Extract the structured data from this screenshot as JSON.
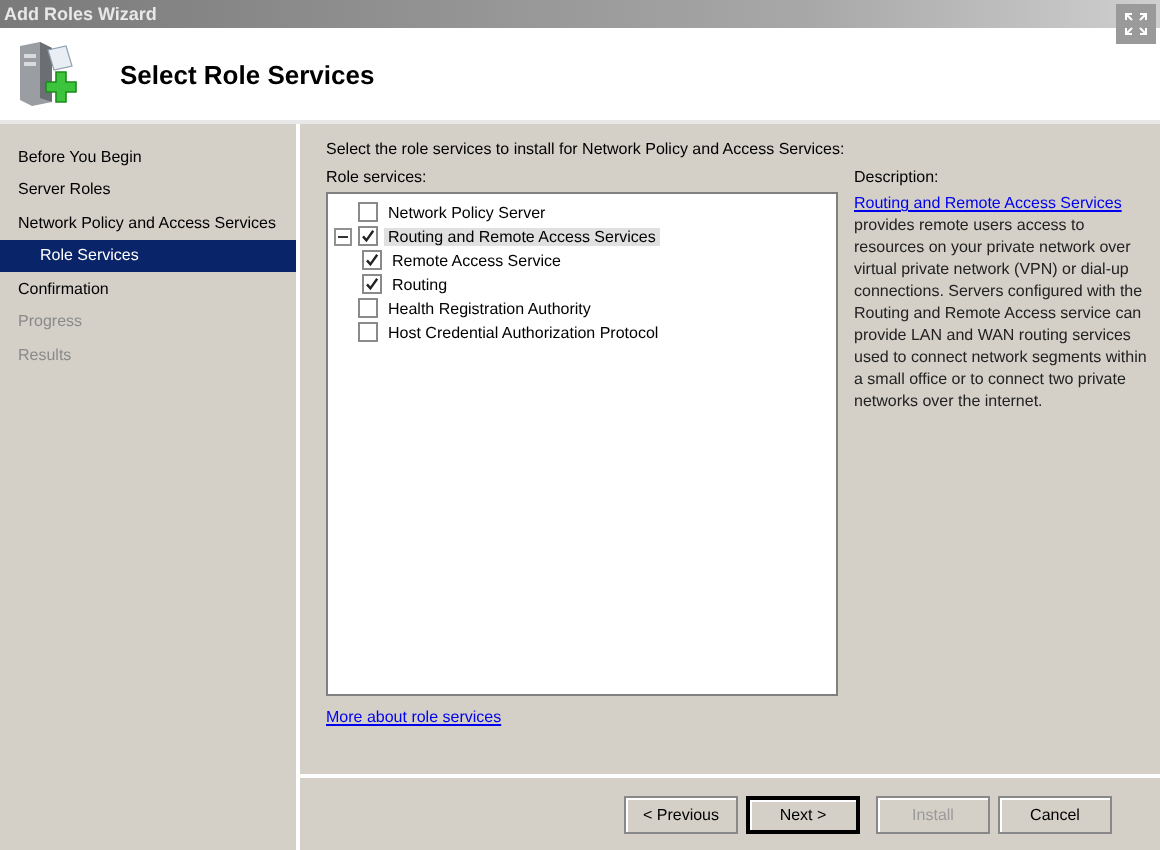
{
  "window": {
    "title": "Add Roles Wizard"
  },
  "header": {
    "title": "Select Role Services"
  },
  "sidebar": {
    "items": [
      {
        "label": "Before You Begin",
        "selected": false,
        "disabled": false
      },
      {
        "label": "Server Roles",
        "selected": false,
        "disabled": false
      },
      {
        "label": "Network Policy and Access Services",
        "selected": false,
        "disabled": false,
        "children": [
          {
            "label": "Role Services",
            "selected": true,
            "disabled": false
          }
        ]
      },
      {
        "label": "Confirmation",
        "selected": false,
        "disabled": false
      },
      {
        "label": "Progress",
        "selected": false,
        "disabled": true
      },
      {
        "label": "Results",
        "selected": false,
        "disabled": true
      }
    ]
  },
  "instruction": "Select the role services to install for Network Policy and Access Services:",
  "role_services": {
    "label": "Role services:",
    "items": [
      {
        "label": "Network Policy Server",
        "checked": false,
        "selected": false
      },
      {
        "label": "Routing and Remote Access Services",
        "checked": true,
        "selected": true,
        "expanded": true,
        "children": [
          {
            "label": "Remote Access Service",
            "checked": true,
            "selected": false
          },
          {
            "label": "Routing",
            "checked": true,
            "selected": false
          }
        ]
      },
      {
        "label": "Health Registration Authority",
        "checked": false,
        "selected": false
      },
      {
        "label": "Host Credential Authorization Protocol",
        "checked": false,
        "selected": false
      }
    ]
  },
  "description": {
    "label": "Description:",
    "link": "Routing and Remote Access Services",
    "text": "provides remote users access to resources on your private network over virtual private network (VPN) or dial-up connections. Servers configured with the Routing and Remote Access service can provide LAN and WAN routing services used to connect network segments within a small office or to connect two private networks over the internet."
  },
  "more_link": "More about role services",
  "buttons": [
    {
      "label": "< Previous",
      "disabled": false,
      "default": false
    },
    {
      "label": "Next >",
      "disabled": false,
      "default": true
    },
    {
      "label": "Install",
      "disabled": true,
      "default": false
    },
    {
      "label": "Cancel",
      "disabled": false,
      "default": false
    }
  ]
}
